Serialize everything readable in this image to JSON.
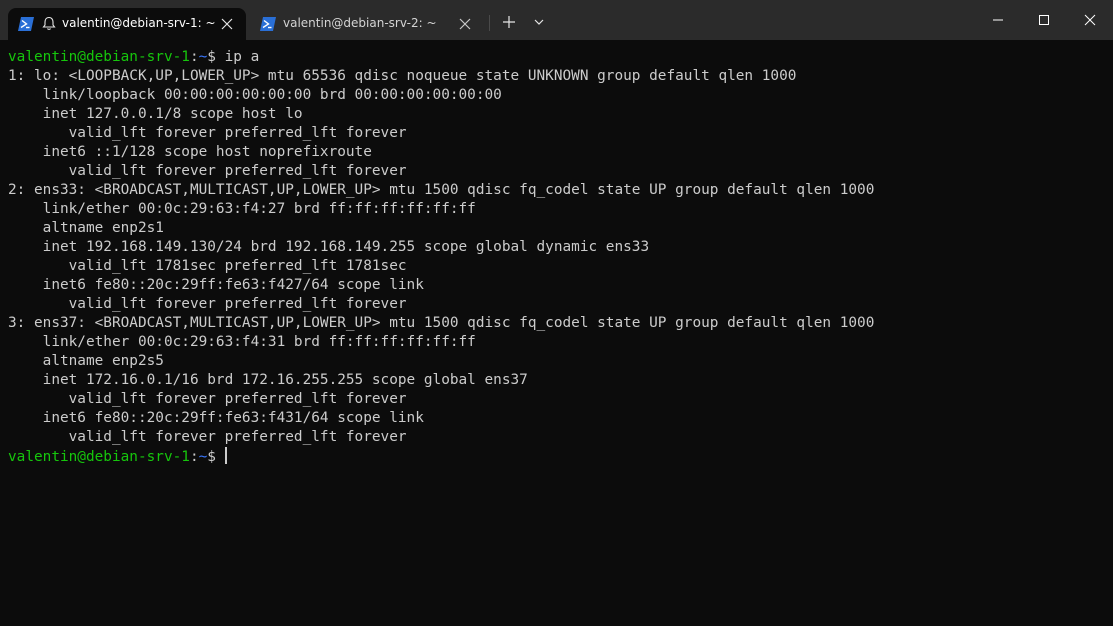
{
  "tabs": [
    {
      "title": "valentin@debian-srv-1: ~",
      "icon": "powershell-icon",
      "active": true,
      "has_bell": true
    },
    {
      "title": "valentin@debian-srv-2: ~",
      "icon": "powershell-icon",
      "active": false,
      "has_bell": false
    }
  ],
  "tabbar": {
    "new_tab_icon": "plus-icon",
    "dropdown_icon": "chevron-down-icon"
  },
  "window_controls": {
    "minimize_icon": "minimize-icon",
    "maximize_icon": "maximize-icon",
    "close_icon": "close-icon"
  },
  "colors": {
    "background": "#0c0c0c",
    "titlebar": "#2b2b2b",
    "foreground": "#cccccc",
    "prompt_user": "#16c60c",
    "prompt_path": "#3b78ff"
  },
  "prompt": {
    "user_host": "valentin@debian-srv-1",
    "separator": ":",
    "path": "~",
    "sign": "$"
  },
  "terminal": {
    "command": " ip a",
    "output": [
      "1: lo: <LOOPBACK,UP,LOWER_UP> mtu 65536 qdisc noqueue state UNKNOWN group default qlen 1000",
      "    link/loopback 00:00:00:00:00:00 brd 00:00:00:00:00:00",
      "    inet 127.0.0.1/8 scope host lo",
      "       valid_lft forever preferred_lft forever",
      "    inet6 ::1/128 scope host noprefixroute",
      "       valid_lft forever preferred_lft forever",
      "2: ens33: <BROADCAST,MULTICAST,UP,LOWER_UP> mtu 1500 qdisc fq_codel state UP group default qlen 1000",
      "    link/ether 00:0c:29:63:f4:27 brd ff:ff:ff:ff:ff:ff",
      "    altname enp2s1",
      "    inet 192.168.149.130/24 brd 192.168.149.255 scope global dynamic ens33",
      "       valid_lft 1781sec preferred_lft 1781sec",
      "    inet6 fe80::20c:29ff:fe63:f427/64 scope link",
      "       valid_lft forever preferred_lft forever",
      "3: ens37: <BROADCAST,MULTICAST,UP,LOWER_UP> mtu 1500 qdisc fq_codel state UP group default qlen 1000",
      "    link/ether 00:0c:29:63:f4:31 brd ff:ff:ff:ff:ff:ff",
      "    altname enp2s5",
      "    inet 172.16.0.1/16 brd 172.16.255.255 scope global ens37",
      "       valid_lft forever preferred_lft forever",
      "    inet6 fe80::20c:29ff:fe63:f431/64 scope link",
      "       valid_lft forever preferred_lft forever"
    ]
  }
}
